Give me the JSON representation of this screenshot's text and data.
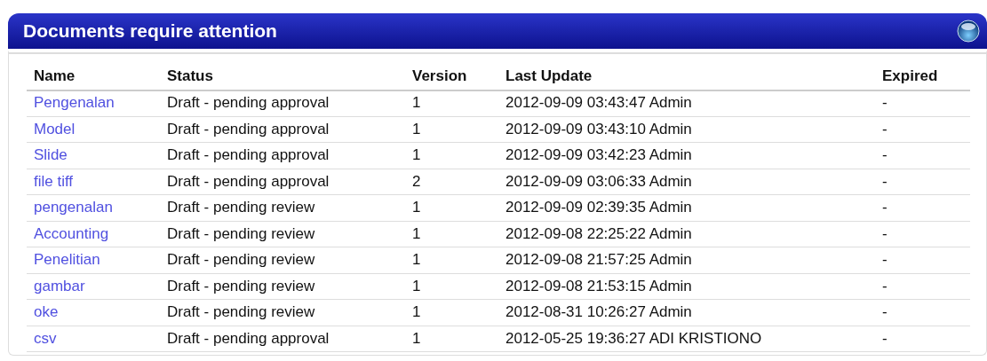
{
  "panel": {
    "title": "Documents require attention"
  },
  "table": {
    "columns": [
      "Name",
      "Status",
      "Version",
      "Last Update",
      "Expired"
    ],
    "rows": [
      {
        "name": "Pengenalan",
        "status": "Draft - pending approval",
        "version": "1",
        "last_update": "2012-09-09 03:43:47 Admin",
        "expired": "-"
      },
      {
        "name": "Model",
        "status": "Draft - pending approval",
        "version": "1",
        "last_update": "2012-09-09 03:43:10 Admin",
        "expired": "-"
      },
      {
        "name": "Slide",
        "status": "Draft - pending approval",
        "version": "1",
        "last_update": "2012-09-09 03:42:23 Admin",
        "expired": "-"
      },
      {
        "name": "file tiff",
        "status": "Draft - pending approval",
        "version": "2",
        "last_update": "2012-09-09 03:06:33 Admin",
        "expired": "-"
      },
      {
        "name": "pengenalan",
        "status": "Draft - pending review",
        "version": "1",
        "last_update": "2012-09-09 02:39:35 Admin",
        "expired": "-"
      },
      {
        "name": "Accounting",
        "status": "Draft - pending review",
        "version": "1",
        "last_update": "2012-09-08 22:25:22 Admin",
        "expired": "-"
      },
      {
        "name": "Penelitian",
        "status": "Draft - pending review",
        "version": "1",
        "last_update": "2012-09-08 21:57:25 Admin",
        "expired": "-"
      },
      {
        "name": "gambar",
        "status": "Draft - pending review",
        "version": "1",
        "last_update": "2012-09-08 21:53:15 Admin",
        "expired": "-"
      },
      {
        "name": "oke",
        "status": "Draft - pending review",
        "version": "1",
        "last_update": "2012-08-31 10:26:27 Admin",
        "expired": "-"
      },
      {
        "name": "csv",
        "status": "Draft - pending approval",
        "version": "1",
        "last_update": "2012-05-25 19:36:27 ADI KRISTIONO",
        "expired": "-"
      }
    ]
  }
}
